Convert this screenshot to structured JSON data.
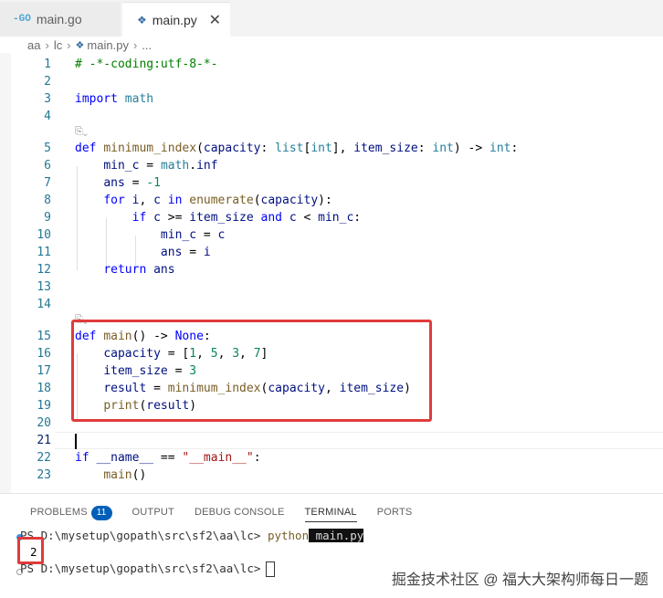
{
  "tabs": [
    {
      "label": "main.go",
      "icon": "go-file-icon",
      "active": false
    },
    {
      "label": "main.py",
      "icon": "python-file-icon",
      "active": true
    }
  ],
  "breadcrumb": {
    "parts": [
      "aa",
      "lc",
      "main.py",
      "..."
    ]
  },
  "code_lines": [
    {
      "n": "1"
    },
    {
      "n": "2"
    },
    {
      "n": "3"
    },
    {
      "n": "4"
    },
    {
      "n": "5"
    },
    {
      "n": "6"
    },
    {
      "n": "7"
    },
    {
      "n": "8"
    },
    {
      "n": "9"
    },
    {
      "n": "10"
    },
    {
      "n": "11"
    },
    {
      "n": "12"
    },
    {
      "n": "13"
    },
    {
      "n": "14"
    },
    {
      "n": "15"
    },
    {
      "n": "16"
    },
    {
      "n": "17"
    },
    {
      "n": "18"
    },
    {
      "n": "19"
    },
    {
      "n": "20"
    },
    {
      "n": "21"
    },
    {
      "n": "22"
    },
    {
      "n": "23"
    }
  ],
  "code": {
    "l1": "# -*-coding:utf-8-*-",
    "l3_kw": "import",
    "l3_mod": "math",
    "l5_def": "def",
    "l5_fn": "minimum_index",
    "l5_p1": "capacity",
    "l5_t1": "list",
    "l5_t1b": "int",
    "l5_p2": "item_size",
    "l5_t2": "int",
    "l5_ret": "int",
    "l6_var": "min_c",
    "l6_mod": "math",
    "l6_attr": "inf",
    "l7_var": "ans",
    "l7_val": "-1",
    "l8_for": "for",
    "l8_i": "i",
    "l8_c": "c",
    "l8_in": "in",
    "l8_fn": "enumerate",
    "l8_arg": "capacity",
    "l9_if": "if",
    "l9_c": "c",
    "l9_is": "item_size",
    "l9_and": "and",
    "l9_c2": "c",
    "l9_mc": "min_c",
    "l10_mc": "min_c",
    "l10_c": "c",
    "l11_ans": "ans",
    "l11_i": "i",
    "l12_ret": "return",
    "l12_ans": "ans",
    "l15_def": "def",
    "l15_fn": "main",
    "l15_ret": "None",
    "l16_var": "capacity",
    "l16_n1": "1",
    "l16_n2": "5",
    "l16_n3": "3",
    "l16_n4": "7",
    "l17_var": "item_size",
    "l17_val": "3",
    "l18_var": "result",
    "l18_fn": "minimum_index",
    "l18_a1": "capacity",
    "l18_a2": "item_size",
    "l19_fn": "print",
    "l19_arg": "result",
    "l22_if": "if",
    "l22_name": "__name__",
    "l22_str": "\"__main__\"",
    "l23_fn": "main"
  },
  "panel": {
    "tabs": [
      "PROBLEMS",
      "OUTPUT",
      "DEBUG CONSOLE",
      "TERMINAL",
      "PORTS"
    ],
    "problems_count": "11",
    "terminal": {
      "prompt1": "PS D:\\mysetup\\gopath\\src\\sf2\\aa\\lc>",
      "cmd": "python",
      "arg": "main.py",
      "output": "2",
      "prompt2": "PS D:\\mysetup\\gopath\\src\\sf2\\aa\\lc>"
    }
  },
  "watermark": "掘金技术社区 @ 福大大架构师每日一题",
  "colors": {
    "keyword": "#0000ff",
    "function": "#795e26",
    "type": "#267f99",
    "number": "#098658",
    "string": "#a31515",
    "variable": "#001080",
    "highlight_box": "#e03b3b",
    "badge": "#005fb8"
  }
}
